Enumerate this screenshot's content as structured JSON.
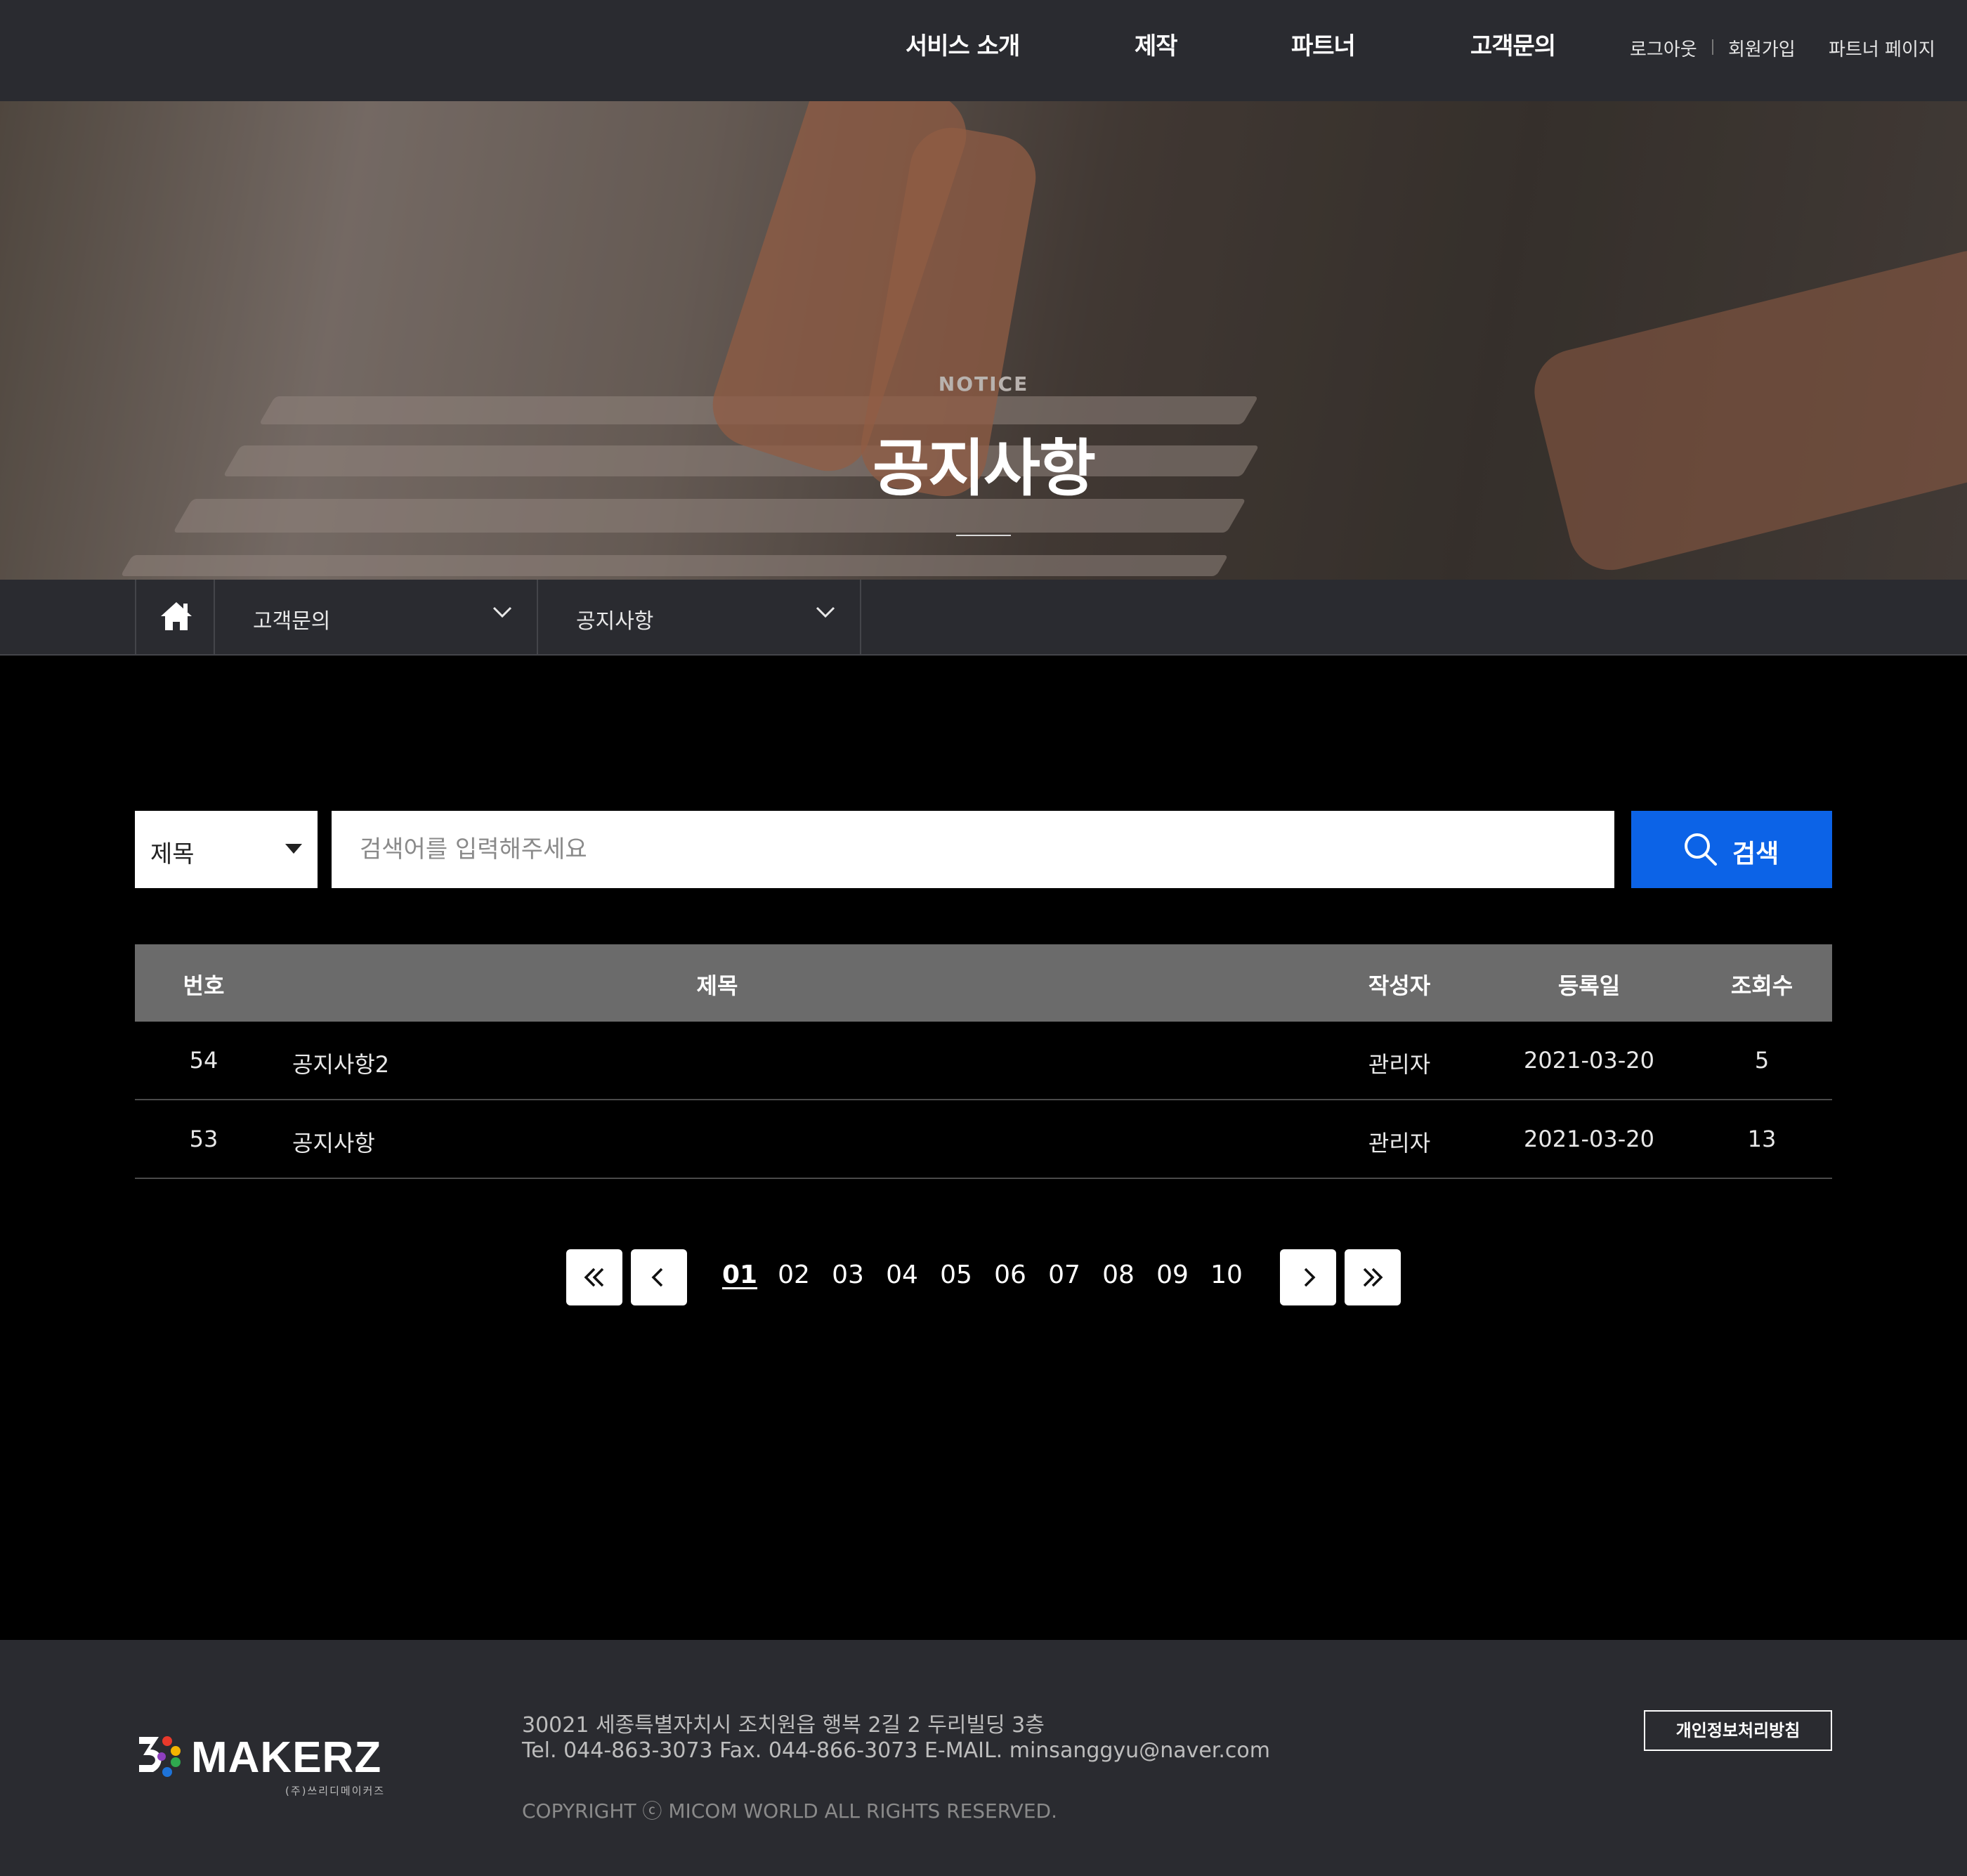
{
  "header": {
    "nav": [
      "서비스 소개",
      "제작",
      "파트너",
      "고객문의"
    ],
    "util": {
      "logout": "로그아웃",
      "signup": "회원가입",
      "partner_page": "파트너 페이지"
    }
  },
  "hero": {
    "subtitle": "NOTICE",
    "title": "공지사항"
  },
  "breadcrumb": {
    "home_icon": "home-icon",
    "level1": "고객문의",
    "level2": "공지사항"
  },
  "search": {
    "field_option": "제목",
    "placeholder": "검색어를 입력해주세요",
    "button_label": "검색"
  },
  "table": {
    "headers": {
      "num": "번호",
      "title": "제목",
      "author": "작성자",
      "date": "등록일",
      "views": "조회수"
    },
    "rows": [
      {
        "num": "54",
        "title": "공지사항2",
        "author": "관리자",
        "date": "2021-03-20",
        "views": "5"
      },
      {
        "num": "53",
        "title": "공지사항",
        "author": "관리자",
        "date": "2021-03-20",
        "views": "13"
      }
    ]
  },
  "pagination": {
    "pages": [
      "01",
      "02",
      "03",
      "04",
      "05",
      "06",
      "07",
      "08",
      "09",
      "10"
    ],
    "current": "01"
  },
  "footer": {
    "logo_text": "MAKERZ",
    "logo_sub": "(주)쓰리디메이커즈",
    "address_line1": "30021   세종특별자치시 조치원읍 행복 2길 2 두리빌딩 3층",
    "address_line2": "Tel. 044-863-3073   Fax. 044-866-3073   E-MAIL. minsanggyu@naver.com",
    "copyright": "COPYRIGHT ⓒ MICOM WORLD ALL RIGHTS RESERVED.",
    "privacy": "개인정보처리방침"
  },
  "colors": {
    "accent": "#0c63e7",
    "header_bg": "#2a2b30",
    "table_header_bg": "#6b6b6b"
  }
}
